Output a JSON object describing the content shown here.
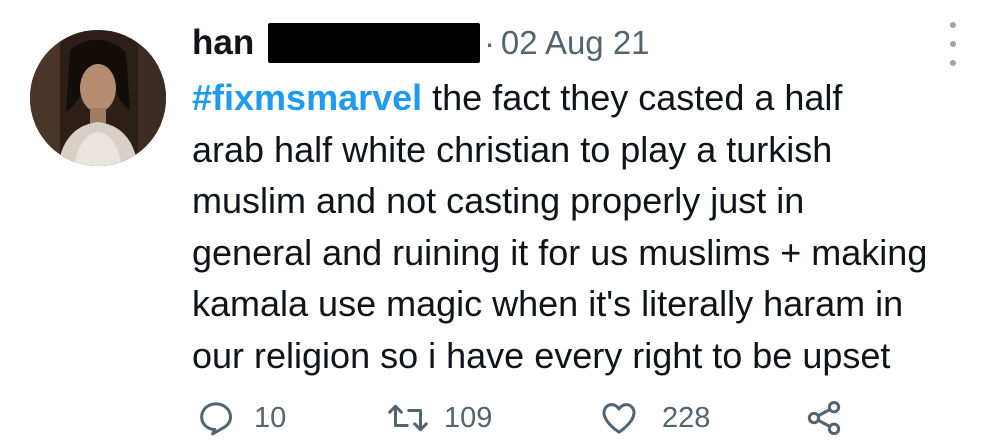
{
  "tweet": {
    "author_name": "han",
    "separator": "·",
    "date": "02 Aug 21",
    "hashtag": "#fixmsmarvel",
    "text_lines": [
      " the fact they casted a half",
      "arab half white christian to play a turkish",
      "muslim and not casting properly just in",
      "general and ruining it for us muslims + making",
      "kamala use magic when it's literally haram in",
      "our religion so i have every right to be upset"
    ]
  },
  "actions": {
    "reply_count": "10",
    "retweet_count": "109",
    "like_count": "228"
  },
  "icons": {
    "reply": "reply-icon",
    "retweet": "retweet-icon",
    "like": "heart-icon",
    "share": "share-icon",
    "more": "more-vertical-icon"
  },
  "colors": {
    "hashtag": "#1d9bf0",
    "secondary_text": "#536471",
    "primary_text": "#0f1419",
    "icon": "#536471"
  }
}
